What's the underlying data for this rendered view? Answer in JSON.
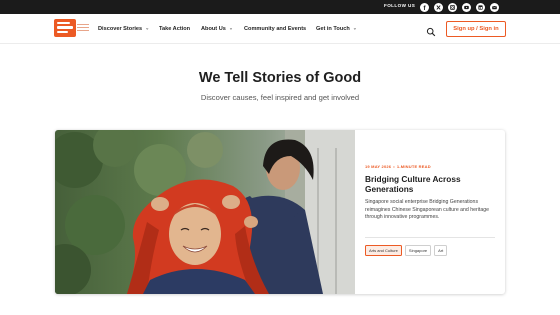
{
  "topbar": {
    "follow_label": "FOLLOW US",
    "socials": [
      {
        "icon": "facebook-icon",
        "glyph": "f"
      },
      {
        "icon": "x-icon",
        "glyph": "𝕏"
      },
      {
        "icon": "instagram-icon",
        "glyph": ""
      },
      {
        "icon": "youtube-icon",
        "glyph": ""
      },
      {
        "icon": "linkedin-icon",
        "glyph": "in"
      },
      {
        "icon": "email-icon",
        "glyph": ""
      }
    ]
  },
  "nav": {
    "items": [
      {
        "label": "Discover Stories",
        "dropdown": true
      },
      {
        "label": "Take Action",
        "dropdown": false
      },
      {
        "label": "About Us",
        "dropdown": true
      },
      {
        "label": "Community and Events",
        "dropdown": false
      },
      {
        "label": "Get in Touch",
        "dropdown": true
      }
    ],
    "signup_label": "Sign up / Sign in"
  },
  "hero": {
    "title": "We Tell Stories of Good",
    "subtitle": "Discover causes, feel inspired and get involved"
  },
  "story": {
    "date": "19 MAY 2026",
    "read_time": "1-MINUTE READ",
    "title": "Bridging Culture Across Generations",
    "description": "Singapore social enterprise Bridging Generations reimagines Chinese Singaporean culture and heritage through innovative programmes.",
    "tags": [
      "Arts and Culture",
      "Singapore",
      "Art"
    ]
  },
  "colors": {
    "accent": "#ec5a24",
    "topbar": "#1b1b1b",
    "text": "#1f1f1f"
  }
}
